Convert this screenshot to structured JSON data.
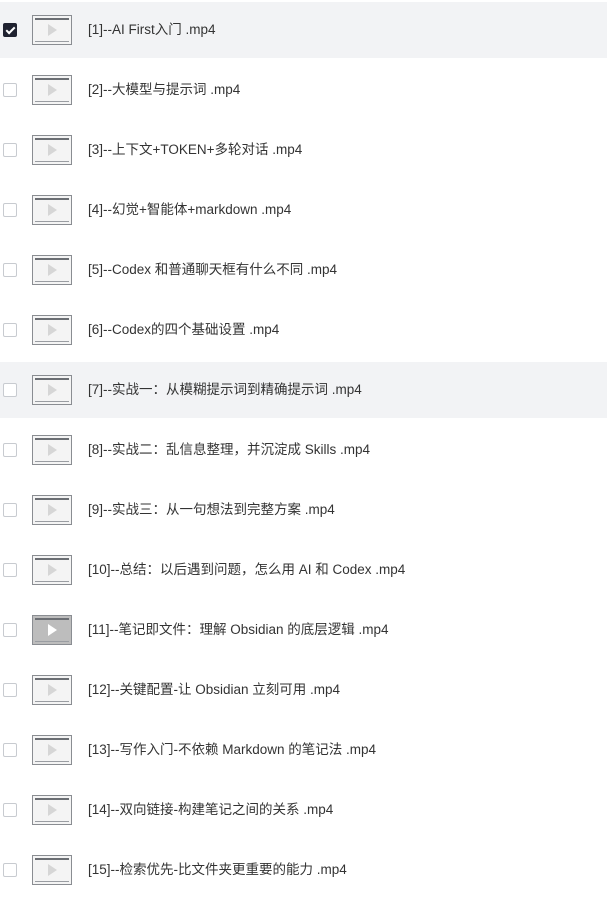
{
  "files": [
    {
      "name": "[1]--AI First入门 .mp4",
      "checked": true,
      "highlight": true,
      "dark": false
    },
    {
      "name": "[2]--大模型与提示词 .mp4",
      "checked": false,
      "highlight": false,
      "dark": false
    },
    {
      "name": "[3]--上下文+TOKEN+多轮对话 .mp4",
      "checked": false,
      "highlight": false,
      "dark": false
    },
    {
      "name": "[4]--幻觉+智能体+markdown .mp4",
      "checked": false,
      "highlight": false,
      "dark": false
    },
    {
      "name": "[5]--Codex 和普通聊天框有什么不同 .mp4",
      "checked": false,
      "highlight": false,
      "dark": false
    },
    {
      "name": "[6]--Codex的四个基础设置 .mp4",
      "checked": false,
      "highlight": false,
      "dark": false
    },
    {
      "name": "[7]--实战一：从模糊提示词到精确提示词 .mp4",
      "checked": false,
      "highlight": true,
      "dark": false
    },
    {
      "name": "[8]--实战二：乱信息整理，并沉淀成 Skills .mp4",
      "checked": false,
      "highlight": false,
      "dark": false
    },
    {
      "name": "[9]--实战三：从一句想法到完整方案 .mp4",
      "checked": false,
      "highlight": false,
      "dark": false
    },
    {
      "name": "[10]--总结：以后遇到问题，怎么用 AI 和 Codex .mp4",
      "checked": false,
      "highlight": false,
      "dark": false
    },
    {
      "name": "[11]--笔记即文件：理解 Obsidian 的底层逻辑 .mp4",
      "checked": false,
      "highlight": false,
      "dark": true
    },
    {
      "name": "[12]--关键配置-让 Obsidian 立刻可用 .mp4",
      "checked": false,
      "highlight": false,
      "dark": false
    },
    {
      "name": "[13]--写作入门-不依赖 Markdown 的笔记法 .mp4",
      "checked": false,
      "highlight": false,
      "dark": false
    },
    {
      "name": "[14]--双向链接-构建笔记之间的关系 .mp4",
      "checked": false,
      "highlight": false,
      "dark": false
    },
    {
      "name": "[15]--检索优先-比文件夹更重要的能力 .mp4",
      "checked": false,
      "highlight": false,
      "dark": false
    }
  ]
}
